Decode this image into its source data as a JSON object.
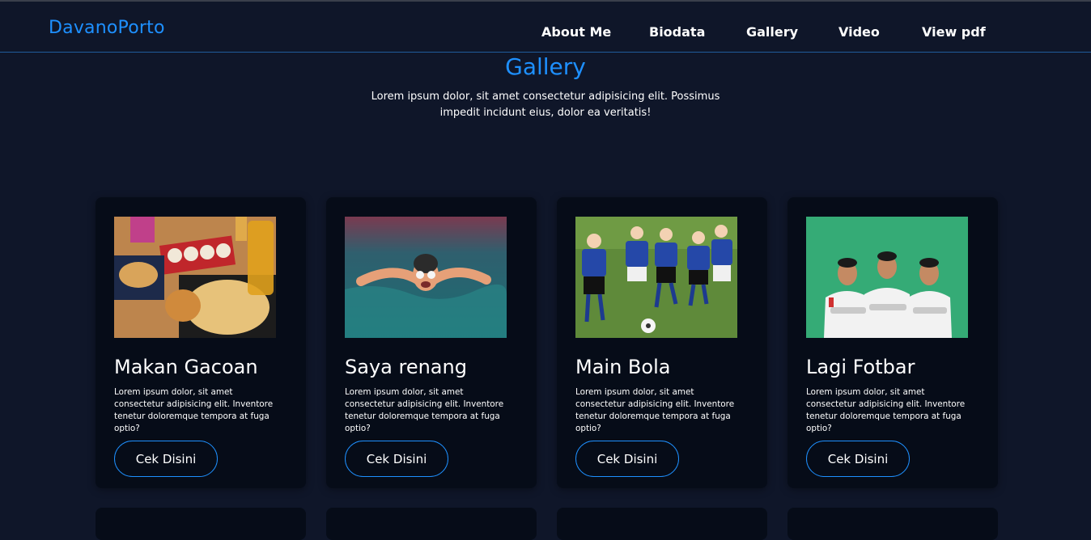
{
  "nav": {
    "logo": "DavanoPorto",
    "links": [
      "About Me",
      "Biodata",
      "Gallery",
      "Video",
      "View pdf"
    ]
  },
  "section": {
    "title": "Gallery",
    "subtitle": "Lorem ipsum dolor, sit amet consectetur adipisicing elit. Possimus impedit incidunt eius, dolor ea veritatis!"
  },
  "cards": [
    {
      "title": "Makan Gacoan",
      "text": "Lorem ipsum dolor, sit amet consectetur adipisicing elit. Inventore tenetur doloremque tempora at fuga optio?",
      "button": "Cek Disini",
      "image": "food-photo"
    },
    {
      "title": "Saya renang",
      "text": "Lorem ipsum dolor, sit amet consectetur adipisicing elit. Inventore tenetur doloremque tempora at fuga optio?",
      "button": "Cek Disini",
      "image": "swimming-photo"
    },
    {
      "title": "Main Bola",
      "text": "Lorem ipsum dolor, sit amet consectetur adipisicing elit. Inventore tenetur doloremque tempora at fuga optio?",
      "button": "Cek Disini",
      "image": "soccer-photo"
    },
    {
      "title": "Lagi Fotbar",
      "text": "Lorem ipsum dolor, sit amet consectetur adipisicing elit. Inventore tenetur doloremque tempora at fuga optio?",
      "button": "Cek Disini",
      "image": "group-photo"
    }
  ],
  "colors": {
    "background": "#0f1629",
    "card": "#060c18",
    "accent": "#1e90ff"
  }
}
